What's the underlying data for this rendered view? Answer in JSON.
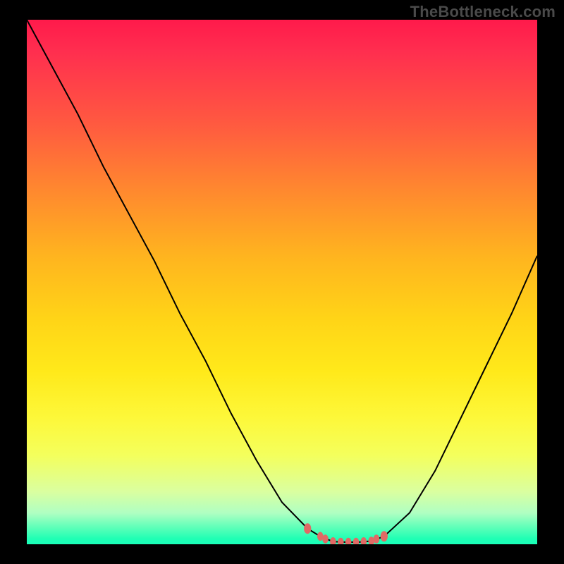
{
  "watermark": "TheBottleneck.com",
  "chart_data": {
    "type": "line",
    "title": "",
    "xlabel": "",
    "ylabel": "",
    "x": [
      0.0,
      0.05,
      0.1,
      0.15,
      0.2,
      0.25,
      0.3,
      0.35,
      0.4,
      0.45,
      0.5,
      0.55,
      0.575,
      0.6,
      0.625,
      0.65,
      0.675,
      0.7,
      0.75,
      0.8,
      0.85,
      0.9,
      0.95,
      1.0
    ],
    "values": [
      100,
      91,
      82,
      72,
      63,
      54,
      44,
      35,
      25,
      16,
      8,
      3,
      1.5,
      0.5,
      0.4,
      0.4,
      0.6,
      1.5,
      6,
      14,
      24,
      34,
      44,
      55
    ],
    "marker_points_x": [
      0.55,
      0.575,
      0.585,
      0.6,
      0.615,
      0.63,
      0.645,
      0.66,
      0.675,
      0.685,
      0.7
    ],
    "marker_points_y": [
      3.0,
      1.5,
      1.0,
      0.5,
      0.4,
      0.4,
      0.4,
      0.5,
      0.6,
      1.0,
      1.5
    ],
    "ylim": [
      0,
      100
    ],
    "xlim": [
      0,
      1
    ],
    "gradient_colors": {
      "top": "#ff1a4b",
      "mid_upper": "#ffb41f",
      "mid": "#ffe91a",
      "mid_lower": "#daffa0",
      "bottom": "#1affb9"
    },
    "curve_color": "#000000",
    "marker_color": "#e06a65"
  }
}
